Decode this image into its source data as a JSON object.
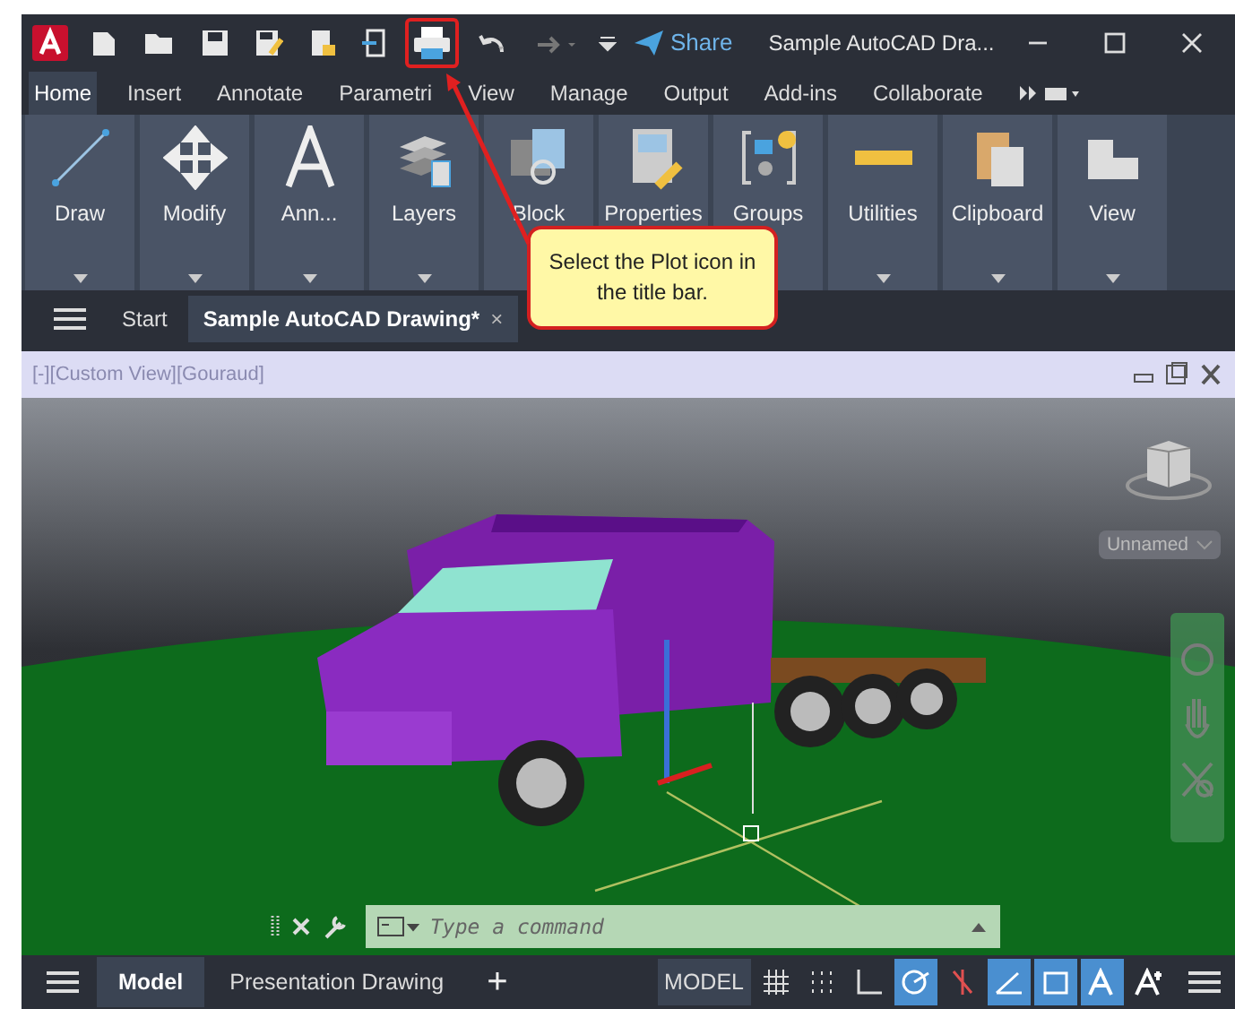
{
  "title_bar": {
    "share": "Share",
    "title": "Sample AutoCAD Dra...",
    "quick_access": [
      {
        "kind": "new",
        "highlighted": false
      },
      {
        "kind": "open",
        "highlighted": false
      },
      {
        "kind": "save",
        "highlighted": false
      },
      {
        "kind": "saveas",
        "highlighted": false
      },
      {
        "kind": "publish",
        "highlighted": false
      },
      {
        "kind": "export",
        "highlighted": false
      },
      {
        "kind": "plot",
        "highlighted": true
      },
      {
        "kind": "undo",
        "highlighted": false
      },
      {
        "kind": "redo",
        "highlighted": false
      }
    ]
  },
  "ribbon_tabs": [
    {
      "label": "Home",
      "selected": true
    },
    {
      "label": "Insert",
      "selected": false
    },
    {
      "label": "Annotate",
      "selected": false
    },
    {
      "label": "Parametri",
      "selected": false
    },
    {
      "label": "View",
      "selected": false
    },
    {
      "label": "Manage",
      "selected": false
    },
    {
      "label": "Output",
      "selected": false
    },
    {
      "label": "Add-ins",
      "selected": false
    },
    {
      "label": "Collaborate",
      "selected": false
    }
  ],
  "ribbon_panels": [
    {
      "label": "Draw",
      "kind": "draw"
    },
    {
      "label": "Modify",
      "kind": "modify"
    },
    {
      "label": "Ann...",
      "kind": "annotation"
    },
    {
      "label": "Layers",
      "kind": "layers"
    },
    {
      "label": "Block",
      "kind": "block"
    },
    {
      "label": "Properties",
      "kind": "properties"
    },
    {
      "label": "Groups",
      "kind": "groups"
    },
    {
      "label": "Utilities",
      "kind": "utilities"
    },
    {
      "label": "Clipboard",
      "kind": "clipboard"
    },
    {
      "label": "View",
      "kind": "view"
    }
  ],
  "file_tabs": [
    {
      "label": "Start",
      "selected": false
    },
    {
      "label": "Sample AutoCAD Drawing*",
      "selected": true,
      "close": "×"
    }
  ],
  "callout": {
    "text": "Select the Plot icon in the title bar."
  },
  "viewport": {
    "label": "[-][Custom View][Gouraud]",
    "view_name": "Unnamed"
  },
  "command_line": {
    "placeholder": "Type a command"
  },
  "layout_tabs": [
    {
      "label": "Model",
      "selected": true
    },
    {
      "label": "Presentation Drawing",
      "selected": false
    }
  ],
  "status_bar": {
    "add_tab": "+",
    "model": "MODEL",
    "toggles": [
      {
        "kind": "grid",
        "on": false
      },
      {
        "kind": "snap",
        "on": false
      },
      {
        "kind": "ortho",
        "on": false
      },
      {
        "kind": "polar",
        "on": true
      },
      {
        "kind": "tracking",
        "on": false
      },
      {
        "kind": "isodraft",
        "on": true
      },
      {
        "kind": "osnap",
        "on": true
      },
      {
        "kind": "annovis",
        "on": true
      },
      {
        "kind": "autoscale",
        "on": false
      }
    ]
  }
}
